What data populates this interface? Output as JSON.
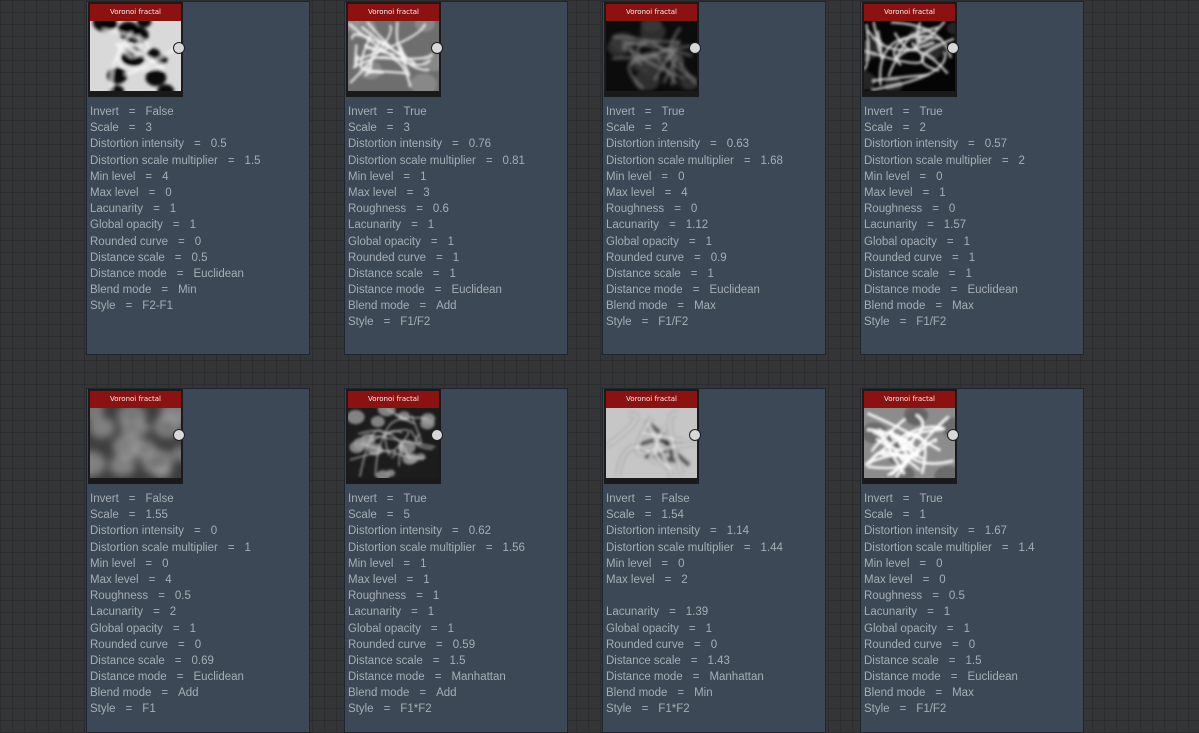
{
  "nodes": [
    {
      "title": "Voronoi fractal",
      "theme": "dark-blobs",
      "props": [
        {
          "label": "Invert",
          "value": "False"
        },
        {
          "label": "Scale",
          "value": "3"
        },
        {
          "label": "Distortion intensity",
          "value": "0.5"
        },
        {
          "label": "Distortion scale multiplier",
          "value": "1.5"
        },
        {
          "label": "Min level",
          "value": "4"
        },
        {
          "label": "Max level",
          "value": "0"
        },
        {
          "label": "Lacunarity",
          "value": "1"
        },
        {
          "label": "Global opacity",
          "value": "1"
        },
        {
          "label": "Rounded curve",
          "value": "0"
        },
        {
          "label": "Distance scale",
          "value": "0.5"
        },
        {
          "label": "Distance mode",
          "value": "Euclidean"
        },
        {
          "label": "Blend mode",
          "value": "Min"
        },
        {
          "label": "Style",
          "value": "F2-F1"
        }
      ]
    },
    {
      "title": "Voronoi fractal",
      "theme": "light-veins",
      "props": [
        {
          "label": "Invert",
          "value": "True"
        },
        {
          "label": "Scale",
          "value": "3"
        },
        {
          "label": "Distortion intensity",
          "value": "0.76"
        },
        {
          "label": "Distortion scale multiplier",
          "value": "0.81"
        },
        {
          "label": "Min level",
          "value": "1"
        },
        {
          "label": "Max level",
          "value": "3"
        },
        {
          "label": "Roughness",
          "value": "0.6"
        },
        {
          "label": "Lacunarity",
          "value": "1"
        },
        {
          "label": "Global opacity",
          "value": "1"
        },
        {
          "label": "Rounded curve",
          "value": "1"
        },
        {
          "label": "Distance scale",
          "value": "1"
        },
        {
          "label": "Distance mode",
          "value": "Euclidean"
        },
        {
          "label": "Blend mode",
          "value": "Add"
        },
        {
          "label": "Style",
          "value": "F1/F2"
        }
      ]
    },
    {
      "title": "Voronoi fractal",
      "theme": "dark-veins",
      "props": [
        {
          "label": "Invert",
          "value": "True"
        },
        {
          "label": "Scale",
          "value": "2"
        },
        {
          "label": "Distortion intensity",
          "value": "0.63"
        },
        {
          "label": "Distortion scale multiplier",
          "value": "1.68"
        },
        {
          "label": "Min level",
          "value": "0"
        },
        {
          "label": "Max level",
          "value": "4"
        },
        {
          "label": "Roughness",
          "value": "0"
        },
        {
          "label": "Lacunarity",
          "value": "1.12"
        },
        {
          "label": "Global opacity",
          "value": "1"
        },
        {
          "label": "Rounded curve",
          "value": "0.9"
        },
        {
          "label": "Distance scale",
          "value": "1"
        },
        {
          "label": "Distance mode",
          "value": "Euclidean"
        },
        {
          "label": "Blend mode",
          "value": "Max"
        },
        {
          "label": "Style",
          "value": "F1/F2"
        }
      ]
    },
    {
      "title": "Voronoi fractal",
      "theme": "dark-glow",
      "props": [
        {
          "label": "Invert",
          "value": "True"
        },
        {
          "label": "Scale",
          "value": "2"
        },
        {
          "label": "Distortion intensity",
          "value": "0.57"
        },
        {
          "label": "Distortion scale multiplier",
          "value": "2"
        },
        {
          "label": "Min level",
          "value": "0"
        },
        {
          "label": "Max level",
          "value": "1"
        },
        {
          "label": "Roughness",
          "value": "0"
        },
        {
          "label": "Lacunarity",
          "value": "1.57"
        },
        {
          "label": "Global opacity",
          "value": "1"
        },
        {
          "label": "Rounded curve",
          "value": "1"
        },
        {
          "label": "Distance scale",
          "value": "1"
        },
        {
          "label": "Distance mode",
          "value": "Euclidean"
        },
        {
          "label": "Blend mode",
          "value": "Max"
        },
        {
          "label": "Style",
          "value": "F1/F2"
        }
      ]
    },
    {
      "title": "Voronoi fractal",
      "theme": "cloud",
      "props": [
        {
          "label": "Invert",
          "value": "False"
        },
        {
          "label": "Scale",
          "value": "1.55"
        },
        {
          "label": "Distortion intensity",
          "value": "0"
        },
        {
          "label": "Distortion scale multiplier",
          "value": "1"
        },
        {
          "label": "Min level",
          "value": "0"
        },
        {
          "label": "Max level",
          "value": "4"
        },
        {
          "label": "Roughness",
          "value": "0.5"
        },
        {
          "label": "Lacunarity",
          "value": "2"
        },
        {
          "label": "Global opacity",
          "value": "1"
        },
        {
          "label": "Rounded curve",
          "value": "0"
        },
        {
          "label": "Distance scale",
          "value": "0.69"
        },
        {
          "label": "Distance mode",
          "value": "Euclidean"
        },
        {
          "label": "Blend mode",
          "value": "Add"
        },
        {
          "label": "Style",
          "value": "F1"
        }
      ]
    },
    {
      "title": "Voronoi fractal",
      "theme": "crystal",
      "props": [
        {
          "label": "Invert",
          "value": "True"
        },
        {
          "label": "Scale",
          "value": "5"
        },
        {
          "label": "Distortion intensity",
          "value": "0.62"
        },
        {
          "label": "Distortion scale multiplier",
          "value": "1.56"
        },
        {
          "label": "Min level",
          "value": "1"
        },
        {
          "label": "Max level",
          "value": "1"
        },
        {
          "label": "Roughness",
          "value": "1"
        },
        {
          "label": "Lacunarity",
          "value": "1"
        },
        {
          "label": "Global opacity",
          "value": "1"
        },
        {
          "label": "Rounded curve",
          "value": "0.59"
        },
        {
          "label": "Distance scale",
          "value": "1.5"
        },
        {
          "label": "Distance mode",
          "value": "Manhattan"
        },
        {
          "label": "Blend mode",
          "value": "Add"
        },
        {
          "label": "Style",
          "value": "F1*F2"
        }
      ]
    },
    {
      "title": "Voronoi fractal",
      "theme": "swirl",
      "props": [
        {
          "label": "Invert",
          "value": "False"
        },
        {
          "label": "Scale",
          "value": "1.54"
        },
        {
          "label": "Distortion intensity",
          "value": "1.14"
        },
        {
          "label": "Distortion scale multiplier",
          "value": "1.44"
        },
        {
          "label": "Min level",
          "value": "0"
        },
        {
          "label": "Max level",
          "value": "2"
        },
        {
          "label": "",
          "value": ""
        },
        {
          "label": "Lacunarity",
          "value": "1.39"
        },
        {
          "label": "Global opacity",
          "value": "1"
        },
        {
          "label": "Rounded curve",
          "value": "0"
        },
        {
          "label": "Distance scale",
          "value": "1.43"
        },
        {
          "label": "Distance mode",
          "value": "Manhattan"
        },
        {
          "label": "Blend mode",
          "value": "Min"
        },
        {
          "label": "Style",
          "value": "F1*F2"
        }
      ]
    },
    {
      "title": "Voronoi fractal",
      "theme": "bright-veins",
      "props": [
        {
          "label": "Invert",
          "value": "True"
        },
        {
          "label": "Scale",
          "value": "1"
        },
        {
          "label": "Distortion intensity",
          "value": "1.67"
        },
        {
          "label": "Distortion scale multiplier",
          "value": "1.4"
        },
        {
          "label": "Min level",
          "value": "0"
        },
        {
          "label": "Max level",
          "value": "0"
        },
        {
          "label": "Roughness",
          "value": "0.5"
        },
        {
          "label": "Lacunarity",
          "value": "1"
        },
        {
          "label": "Global opacity",
          "value": "1"
        },
        {
          "label": "Rounded curve",
          "value": "0"
        },
        {
          "label": "Distance scale",
          "value": "1.5"
        },
        {
          "label": "Distance mode",
          "value": "Euclidean"
        },
        {
          "label": "Blend mode",
          "value": "Max"
        },
        {
          "label": "Style",
          "value": "F1/F2"
        }
      ]
    }
  ]
}
